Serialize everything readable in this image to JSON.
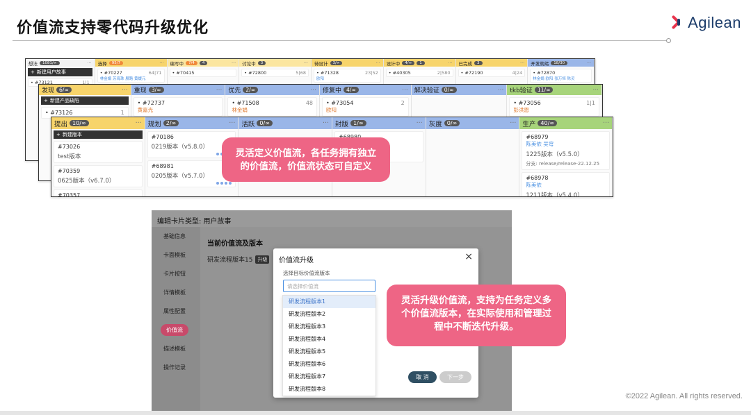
{
  "slide_title": "价值流支持零代码升级优化",
  "brand": "Agilean",
  "copyright": "©2022 Agilean. All rights reserved.",
  "board1": {
    "columns": [
      {
        "name": "想法",
        "count": "1081/∞",
        "new": "新建用户故事",
        "card": "#73121",
        "num": "1|1"
      },
      {
        "name": "选择",
        "count": "95/7",
        "card": "#70227",
        "num": "64|71",
        "who": "林金娟 苏海珠 展路 黄媛元"
      },
      {
        "name": "需求编写",
        "count": "7/4",
        "sub": "编写中",
        "subcount": "4",
        "card": "#70415"
      },
      {
        "name": "讨论中",
        "sub": "讨论中",
        "subcount": "3",
        "card": "#72800",
        "num": "5|68",
        "num2": "4|14"
      },
      {
        "name": "待设计",
        "count": "3/∞",
        "card": "#71328",
        "num": "23|52",
        "who": "欧阳"
      },
      {
        "name": "设计",
        "count": "4/∞",
        "sub": "设计中",
        "subcount": "1",
        "card": "#40305",
        "num": "2|580"
      },
      {
        "name": "已完成",
        "sub": "已完成",
        "subcount": "3",
        "card": "#72190",
        "num": "4|24"
      },
      {
        "name": "开发就绪",
        "count": "18/30",
        "card": "#72870",
        "who": "林金娟 欧阳 张万恒 陈灵"
      }
    ]
  },
  "board2": {
    "columns": [
      {
        "name": "发现",
        "count": "6/∞",
        "new": "新建产品缺陷",
        "card": "#73126",
        "num": "1"
      },
      {
        "name": "重现",
        "count": "3/∞",
        "card": "#72737",
        "who": "黄嘉光"
      },
      {
        "name": "优先",
        "count": "2/∞",
        "card": "#71508",
        "num": "48",
        "who": "林金娟"
      },
      {
        "name": "修复中",
        "count": "4/∞",
        "card": "#73054",
        "num": "2",
        "who": "欧阳"
      },
      {
        "name": "解决验证",
        "count": "0/∞"
      },
      {
        "name": "tkb验证",
        "count": "11/∞",
        "card": "#73056",
        "num": "1|1",
        "who": "彭洪恩"
      }
    ]
  },
  "board3": {
    "columns": [
      {
        "name": "提出",
        "count": "10/∞",
        "new": "新建版本",
        "cards": [
          {
            "id": "#73026",
            "sub": "test版本"
          },
          {
            "id": "#70359",
            "sub": "0625版本（v6.7.0）"
          },
          {
            "id": "#70357",
            "sub": ""
          }
        ]
      },
      {
        "name": "规划",
        "count": "2/∞",
        "cards": [
          {
            "id": "#70186",
            "sub": "0219版本（v5.8.0）"
          },
          {
            "id": "#68981",
            "sub": "0205版本（v5.7.0）"
          }
        ]
      },
      {
        "name": "活跃",
        "count": "0/∞",
        "cards": []
      },
      {
        "name": "封版",
        "count": "1/∞",
        "cards": [
          {
            "id": "#68980",
            "sub": "陈美依",
            "sub2": "(v5.6.0)"
          }
        ]
      },
      {
        "name": "灰度",
        "count": "0/∞",
        "cards": []
      },
      {
        "name": "生产",
        "count": "40/∞",
        "cards": [
          {
            "id": "#68979",
            "who": "陈美依  吴穹",
            "sub": "1225版本（v5.5.0）",
            "branch": "分支: release/release-22.12.25"
          },
          {
            "id": "#68978",
            "who": "陈美依",
            "sub": "1211版本（v5.4.0）"
          }
        ]
      }
    ]
  },
  "bubble1": "灵活定义价值流，各任务拥有独立的价值流，价值流状态可自定义",
  "bubble2": "灵活升级价值流，支持为任务定义多个价值流版本，在实际使用和管理过程中不断迭代升级。",
  "editor": {
    "header": "编辑卡片类型: 用户故事",
    "side": [
      "基础信息",
      "卡面模板",
      "卡片按钮",
      "详情模板",
      "属性配置",
      "价值流",
      "描述模板",
      "操作记录"
    ],
    "active": "价值流",
    "section_title": "当前价值流及版本",
    "current_version": "研发流程版本15",
    "upgrade_tag": "升级"
  },
  "modal": {
    "title": "价值流升级",
    "close": "×",
    "label": "选择目标价值流版本",
    "placeholder": "请选择价值流",
    "options": [
      "研发流程版本1",
      "研发流程版本2",
      "研发流程版本3",
      "研发流程版本4",
      "研发流程版本5",
      "研发流程版本6",
      "研发流程版本7",
      "研发流程版本8"
    ],
    "selected_index": 0,
    "cancel": "取 消",
    "next": "下一步"
  },
  "colors": {
    "accent_pink": "#ee6585",
    "header_yellow": "#f7d46b",
    "header_blue": "#9ab6e8",
    "header_green": "#a7d47b",
    "logo_red": "#e8344d",
    "logo_blue": "#1d3d6b"
  }
}
